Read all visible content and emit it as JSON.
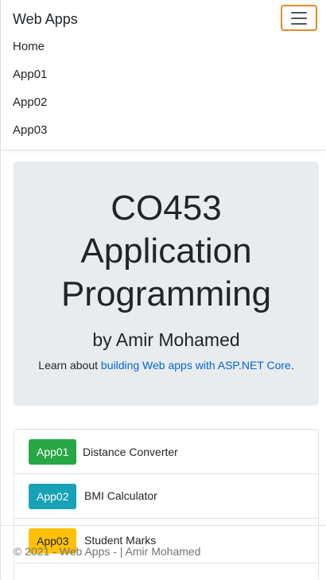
{
  "navbar": {
    "brand": "Web Apps",
    "items": [
      "Home",
      "App01",
      "App02",
      "App03"
    ],
    "toggler_color": "#e08a2c"
  },
  "jumbotron": {
    "title_lines": [
      "CO453",
      "Application",
      "Programming"
    ],
    "author": "by Amir Mohamed",
    "lead_prefix": "Learn about ",
    "lead_link": "building Web apps with ASP.NET Core",
    "lead_suffix": "."
  },
  "apps": [
    {
      "badge": "App01",
      "label": "Distance Converter",
      "color": "#28a745"
    },
    {
      "badge": "App02",
      "label": "BMI Calculator",
      "color": "#17a2b8"
    },
    {
      "badge": "App03",
      "label": "Student Marks",
      "color": "#ffc107"
    }
  ],
  "footer": {
    "text": "© 2021 - Web Apps - | Amir Mohamed"
  }
}
